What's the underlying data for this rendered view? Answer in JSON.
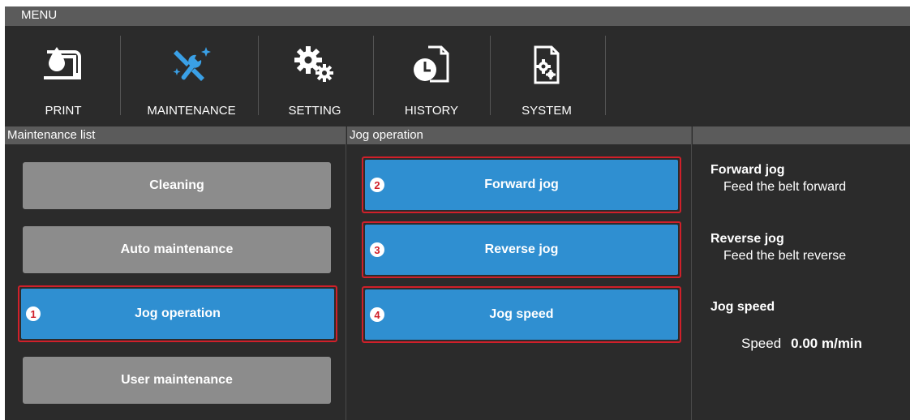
{
  "menu_title": "MENU",
  "nav": [
    {
      "label": "PRINT",
      "icon": "print-icon"
    },
    {
      "label": "MAINTENANCE",
      "icon": "maintenance-icon"
    },
    {
      "label": "SETTING",
      "icon": "setting-icon"
    },
    {
      "label": "HISTORY",
      "icon": "history-icon"
    },
    {
      "label": "SYSTEM",
      "icon": "system-icon"
    }
  ],
  "maintenance_list": {
    "header": "Maintenance list",
    "items": [
      "Cleaning",
      "Auto maintenance",
      "Jog operation",
      "User maintenance"
    ],
    "selected_marker": "1"
  },
  "jog_operation": {
    "header": "Jog operation",
    "buttons": [
      {
        "label": "Forward jog",
        "marker": "2"
      },
      {
        "label": "Reverse jog",
        "marker": "3"
      },
      {
        "label": "Jog speed",
        "marker": "4"
      }
    ]
  },
  "info": {
    "forward_title": "Forward jog",
    "forward_desc": "Feed the belt forward",
    "reverse_title": "Reverse jog",
    "reverse_desc": "Feed the belt reverse",
    "speed_title": "Jog speed",
    "speed_label": "Speed",
    "speed_value": "0.00 m/min"
  },
  "colors": {
    "accent": "#2f8fd1",
    "accent_icon": "#3aa0e6",
    "highlight": "#d0202a",
    "button_gray": "#8c8c8c",
    "background": "#2b2b2b"
  }
}
